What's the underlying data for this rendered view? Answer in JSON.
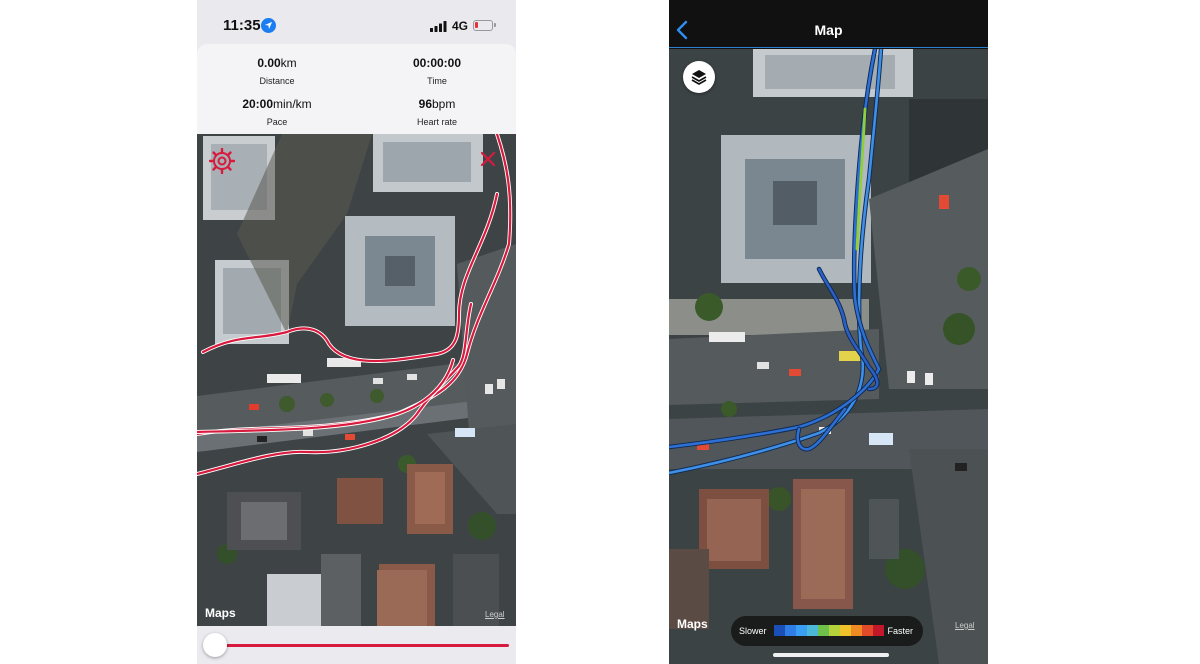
{
  "left_phone": {
    "status_bar": {
      "time": "11:35",
      "network": "4G"
    },
    "stats": [
      {
        "value": "0.00",
        "unit": "km",
        "label": "Distance"
      },
      {
        "value": "00:00:00",
        "unit": "",
        "label": "Time"
      },
      {
        "value": "20:00",
        "unit": "min/km",
        "label": "Pace"
      },
      {
        "value": "96",
        "unit": "bpm",
        "label": "Heart rate"
      }
    ],
    "map": {
      "attribution": "Maps",
      "legal": "Legal",
      "route_color": "#d71a3d"
    },
    "playback_slider": {
      "position": 0
    }
  },
  "right_phone": {
    "nav": {
      "title": "Map"
    },
    "map": {
      "attribution": "Maps",
      "legal": "Legal"
    },
    "speed_legend": {
      "slow_label": "Slower",
      "fast_label": "Faster",
      "colors": [
        "#1a4fb8",
        "#2f7ee8",
        "#3a9ef2",
        "#4cb8d8",
        "#6fc04a",
        "#b6d23a",
        "#f0c22a",
        "#f08a22",
        "#e24a2a",
        "#c2182a"
      ]
    }
  },
  "icons": {
    "location": "location-arrow-icon",
    "signal": "signal-bars-icon",
    "battery": "battery-low-icon",
    "gear": "gear-icon",
    "close": "close-icon",
    "back": "chevron-left-icon",
    "layers": "layers-icon"
  }
}
